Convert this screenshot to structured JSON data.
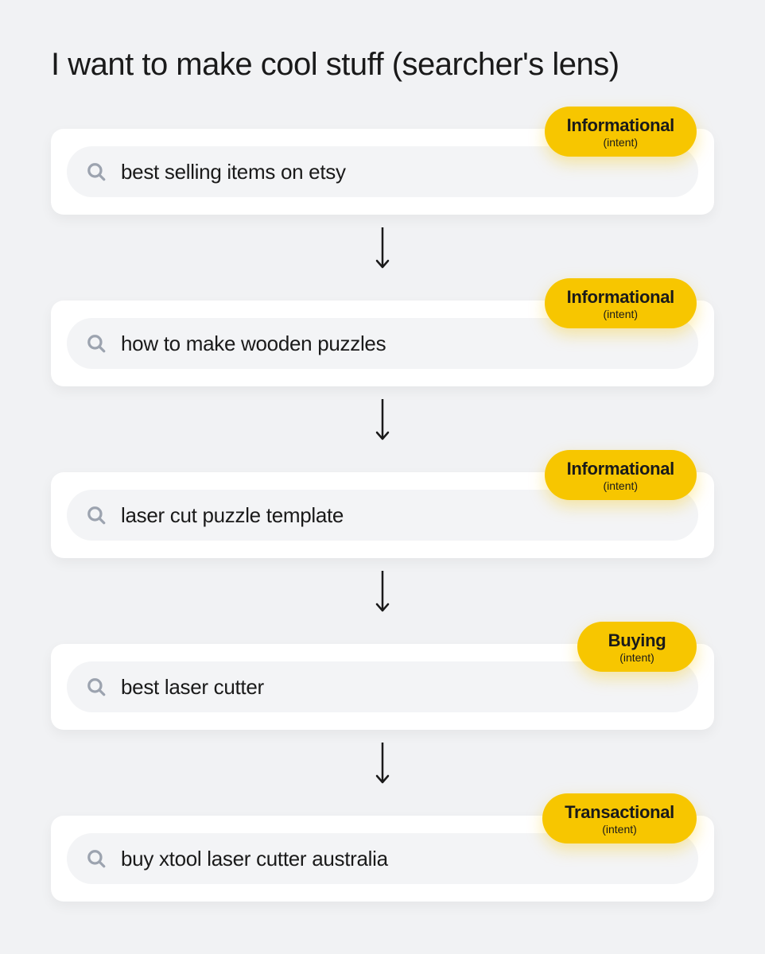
{
  "title": "I want to make cool stuff (searcher's lens)",
  "intent_sub": "(intent)",
  "steps": [
    {
      "query": "best selling items on etsy",
      "intent": "Informational"
    },
    {
      "query": "how to make wooden puzzles",
      "intent": "Informational"
    },
    {
      "query": "laser cut puzzle template",
      "intent": "Informational"
    },
    {
      "query": "best laser cutter",
      "intent": "Buying"
    },
    {
      "query": "buy xtool laser cutter australia",
      "intent": "Transactional"
    }
  ],
  "colors": {
    "badge": "#f7c600",
    "bg": "#f1f2f4",
    "card": "#ffffff",
    "searchbar": "#f3f4f6",
    "icon": "#9ca3af"
  }
}
